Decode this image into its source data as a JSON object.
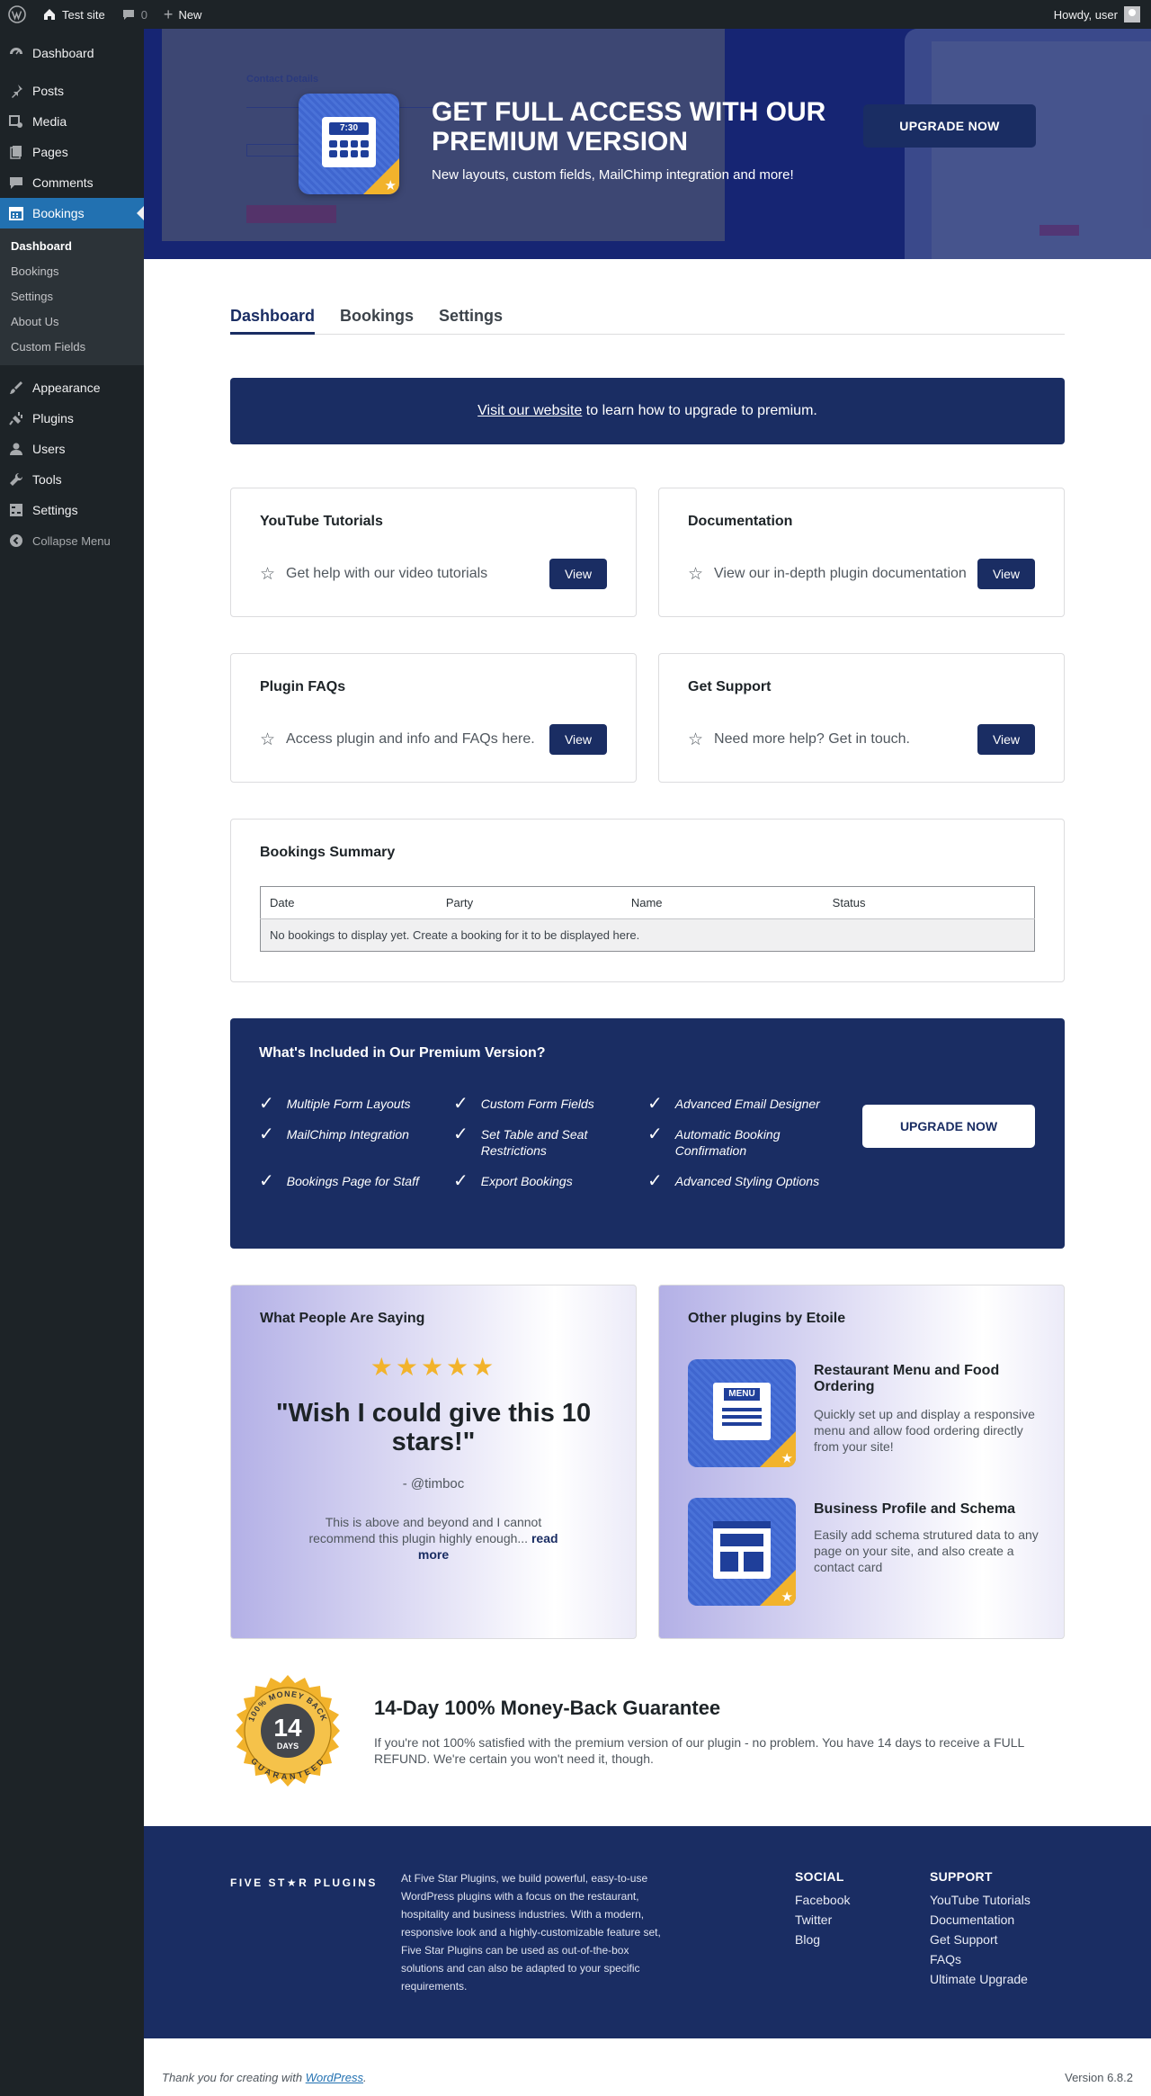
{
  "adminbar": {
    "site_name": "Test site",
    "comments_count": "0",
    "new_label": "New",
    "howdy": "Howdy, user"
  },
  "sidebar": {
    "items_top": [
      {
        "label": "Dashboard",
        "icon": "dashboard-icon"
      }
    ],
    "items_main": [
      {
        "label": "Posts",
        "icon": "pin-icon"
      },
      {
        "label": "Media",
        "icon": "media-icon"
      },
      {
        "label": "Pages",
        "icon": "pages-icon"
      },
      {
        "label": "Comments",
        "icon": "comment-icon"
      },
      {
        "label": "Bookings",
        "icon": "calendar-icon"
      }
    ],
    "submenu": [
      "Dashboard",
      "Bookings",
      "Settings",
      "About Us",
      "Custom Fields"
    ],
    "items_bottom": [
      {
        "label": "Appearance",
        "icon": "brush-icon"
      },
      {
        "label": "Plugins",
        "icon": "plug-icon"
      },
      {
        "label": "Users",
        "icon": "user-icon"
      },
      {
        "label": "Tools",
        "icon": "wrench-icon"
      },
      {
        "label": "Settings",
        "icon": "settings-icon"
      }
    ],
    "collapse": "Collapse Menu"
  },
  "banner": {
    "clock_time": "7:30",
    "title": "GET FULL ACCESS WITH OUR PREMIUM VERSION",
    "subtitle": "New layouts, custom fields, MailChimp integration and more!",
    "button": "UPGRADE NOW",
    "screenshot_heading": "Contact Details"
  },
  "tabs": [
    "Dashboard",
    "Bookings",
    "Settings"
  ],
  "visit": {
    "link": "Visit our website",
    "rest": " to learn how to upgrade to premium."
  },
  "cards": [
    {
      "title": "YouTube Tutorials",
      "text": "Get help with our video tutorials",
      "button": "View"
    },
    {
      "title": "Documentation",
      "text": "View our in-depth plugin documentation",
      "button": "View"
    },
    {
      "title": "Plugin FAQs",
      "text": "Access plugin and info and FAQs here.",
      "button": "View"
    },
    {
      "title": "Get Support",
      "text": "Need more help? Get in touch.",
      "button": "View"
    }
  ],
  "summary": {
    "title": "Bookings Summary",
    "columns": [
      "Date",
      "Party",
      "Name",
      "Status"
    ],
    "empty": "No bookings to display yet. Create a booking for it to be displayed here."
  },
  "premium": {
    "title": "What's Included in Our Premium Version?",
    "features": [
      "Multiple Form Layouts",
      "Custom Form Fields",
      "Advanced Email Designer",
      "MailChimp Integration",
      "Set Table and Seat Restrictions",
      "Automatic Booking Confirmation",
      "Bookings Page for Staff",
      "Export Bookings",
      "Advanced Styling Options"
    ],
    "button": "UPGRADE NOW"
  },
  "testimonial": {
    "title": "What People Are Saying",
    "rating": 5,
    "quote": "\"Wish I could give this 10 stars!\"",
    "author": "- @timboc",
    "body": "This is above and beyond and I cannot recommend this plugin highly enough...",
    "read_more": "read more"
  },
  "plugins": {
    "title": "Other plugins by Etoile",
    "items": [
      {
        "name": "Restaurant Menu and Food Ordering",
        "desc": "Quickly set up and display a responsive menu and allow food ordering directly from your site!",
        "icon_label": "MENU"
      },
      {
        "name": "Business Profile and Schema",
        "desc": "Easily add schema strutured data to any page on your site, and also create a contact card"
      }
    ]
  },
  "guarantee": {
    "seal_top": "100% MONEY BACK",
    "seal_num": "14",
    "seal_days": "DAYS",
    "seal_bottom": "GUARANTEED",
    "title": "14-Day 100% Money-Back Guarantee",
    "text": "If you're not 100% satisfied with the premium version of our plugin - no problem. You have 14 days to receive a FULL REFUND. We're certain you won't need it, though."
  },
  "footer": {
    "logo": "FIVE ST★R PLUGINS",
    "about": "At Five Star Plugins, we build powerful, easy-to-use WordPress plugins with a focus on the restaurant, hospitality and business industries. With a modern, responsive look and a highly-customizable feature set, Five Star Plugins can be used as out-of-the-box solutions and can also be adapted to your specific requirements.",
    "social_title": "SOCIAL",
    "social": [
      "Facebook",
      "Twitter",
      "Blog"
    ],
    "support_title": "SUPPORT",
    "support": [
      "YouTube Tutorials",
      "Documentation",
      "Get Support",
      "FAQs",
      "Ultimate Upgrade"
    ]
  },
  "wpfooter": {
    "thanks": "Thank you for creating with ",
    "wp": "WordPress",
    "dot": ".",
    "version": "Version 6.8.2"
  },
  "colors": {
    "primary": "#1a2d63",
    "accent": "#2271b1",
    "star": "#f2b32c",
    "admin_dark": "#1d2327"
  }
}
